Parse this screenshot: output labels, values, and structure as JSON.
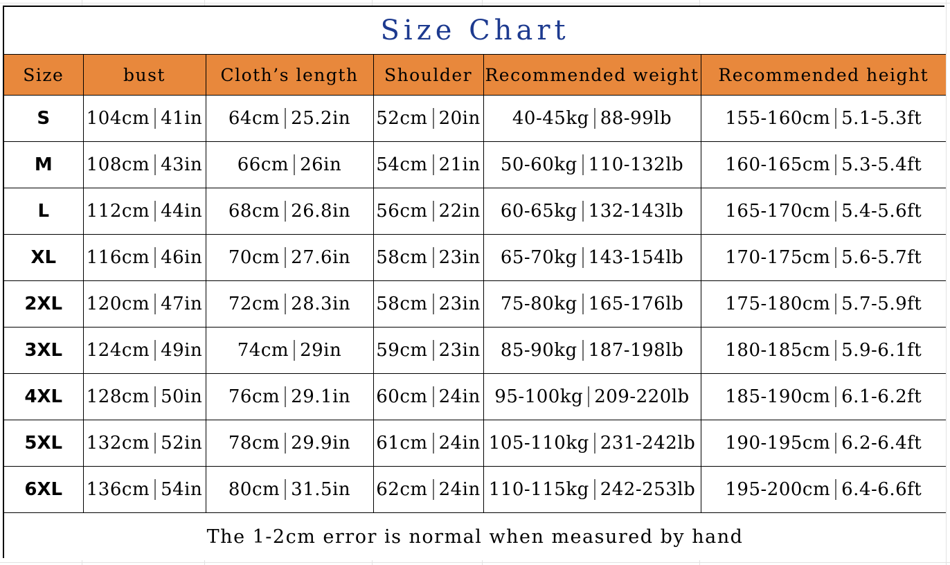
{
  "title": "Size Chart",
  "colors": {
    "header_background": "#e8883c",
    "title_text": "#1d3a8f",
    "border": "#000000",
    "separator": "#6f6f6f",
    "cell_background": "#ffffff"
  },
  "table": {
    "columns": [
      "Size",
      "bust",
      "Cloth’s length",
      "Shoulder",
      "Recommended weight",
      "Recommended height"
    ],
    "rows": [
      {
        "size": "S",
        "bust": {
          "metric": "104cm",
          "imperial": "41in"
        },
        "length": {
          "metric": "64cm",
          "imperial": "25.2in"
        },
        "shoulder": {
          "metric": "52cm",
          "imperial": "20in"
        },
        "weight": {
          "metric": "40-45kg",
          "imperial": "88-99lb"
        },
        "height": {
          "metric": "155-160cm",
          "imperial": "5.1-5.3ft"
        }
      },
      {
        "size": "M",
        "bust": {
          "metric": "108cm",
          "imperial": "43in"
        },
        "length": {
          "metric": "66cm",
          "imperial": "26in"
        },
        "shoulder": {
          "metric": "54cm",
          "imperial": "21in"
        },
        "weight": {
          "metric": "50-60kg",
          "imperial": "110-132lb"
        },
        "height": {
          "metric": "160-165cm",
          "imperial": "5.3-5.4ft"
        }
      },
      {
        "size": "L",
        "bust": {
          "metric": "112cm",
          "imperial": "44in"
        },
        "length": {
          "metric": "68cm",
          "imperial": "26.8in"
        },
        "shoulder": {
          "metric": "56cm",
          "imperial": "22in"
        },
        "weight": {
          "metric": "60-65kg",
          "imperial": "132-143lb"
        },
        "height": {
          "metric": "165-170cm",
          "imperial": "5.4-5.6ft"
        }
      },
      {
        "size": "XL",
        "bust": {
          "metric": "116cm",
          "imperial": "46in"
        },
        "length": {
          "metric": "70cm",
          "imperial": "27.6in"
        },
        "shoulder": {
          "metric": "58cm",
          "imperial": "23in"
        },
        "weight": {
          "metric": "65-70kg",
          "imperial": "143-154lb"
        },
        "height": {
          "metric": "170-175cm",
          "imperial": "5.6-5.7ft"
        }
      },
      {
        "size": "2XL",
        "bust": {
          "metric": "120cm",
          "imperial": "47in"
        },
        "length": {
          "metric": "72cm",
          "imperial": "28.3in"
        },
        "shoulder": {
          "metric": "58cm",
          "imperial": "23in"
        },
        "weight": {
          "metric": "75-80kg",
          "imperial": "165-176lb"
        },
        "height": {
          "metric": "175-180cm",
          "imperial": "5.7-5.9ft"
        }
      },
      {
        "size": "3XL",
        "bust": {
          "metric": "124cm",
          "imperial": "49in"
        },
        "length": {
          "metric": "74cm",
          "imperial": "29in"
        },
        "shoulder": {
          "metric": "59cm",
          "imperial": "23in"
        },
        "weight": {
          "metric": "85-90kg",
          "imperial": "187-198lb"
        },
        "height": {
          "metric": "180-185cm",
          "imperial": "5.9-6.1ft"
        }
      },
      {
        "size": "4XL",
        "bust": {
          "metric": "128cm",
          "imperial": "50in"
        },
        "length": {
          "metric": "76cm",
          "imperial": "29.1in"
        },
        "shoulder": {
          "metric": "60cm",
          "imperial": "24in"
        },
        "weight": {
          "metric": "95-100kg",
          "imperial": "209-220lb"
        },
        "height": {
          "metric": "185-190cm",
          "imperial": "6.1-6.2ft"
        }
      },
      {
        "size": "5XL",
        "bust": {
          "metric": "132cm",
          "imperial": "52in"
        },
        "length": {
          "metric": "78cm",
          "imperial": "29.9in"
        },
        "shoulder": {
          "metric": "61cm",
          "imperial": "24in"
        },
        "weight": {
          "metric": "105-110kg",
          "imperial": "231-242lb"
        },
        "height": {
          "metric": "190-195cm",
          "imperial": "6.2-6.4ft"
        }
      },
      {
        "size": "6XL",
        "bust": {
          "metric": "136cm",
          "imperial": "54in"
        },
        "length": {
          "metric": "80cm",
          "imperial": "31.5in"
        },
        "shoulder": {
          "metric": "62cm",
          "imperial": "24in"
        },
        "weight": {
          "metric": "110-115kg",
          "imperial": "242-253lb"
        },
        "height": {
          "metric": "195-200cm",
          "imperial": "6.4-6.6ft"
        }
      }
    ]
  },
  "footer_note": "The 1-2cm error is normal when measured by hand"
}
